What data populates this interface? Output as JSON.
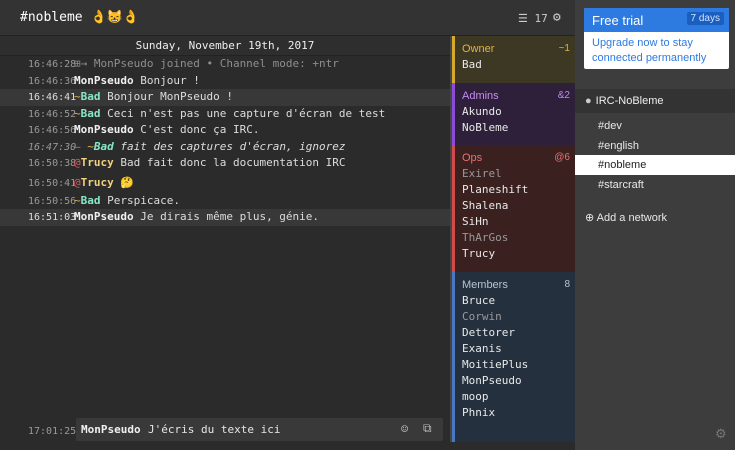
{
  "header": {
    "channel_name": "#nobleme",
    "channel_emoji": "👌😸👌",
    "user_count": "17",
    "userlist_icon": "list-icon",
    "settings_icon": "gear-icon"
  },
  "chat": {
    "date_divider": "Sunday, November 19th, 2017",
    "messages": [
      {
        "time": "16:46:28",
        "type": "join",
        "text": "⊞→ MonPseudo joined  •  Channel mode: +ntr"
      },
      {
        "time": "16:46:36",
        "nick": "MonPseudo",
        "text": "Bonjour !"
      },
      {
        "time": "16:46:41",
        "prefix": "~",
        "nick": "Bad",
        "text": "Bonjour MonPseudo !"
      },
      {
        "time": "16:46:52",
        "prefix": "~",
        "nick": "Bad",
        "text": "Ceci n'est pas une capture d'écran de test"
      },
      {
        "time": "16:46:56",
        "nick": "MonPseudo",
        "text": "C'est donc ça IRC."
      },
      {
        "time": "16:47:30",
        "type": "action",
        "prefix": "~",
        "nick": "Bad",
        "text": "fait des captures d'écran, ignorez"
      },
      {
        "time": "16:50:38",
        "prefix": "@",
        "nick": "Trucy",
        "text": "Bad fait donc la documentation IRC"
      },
      {
        "time": "16:50:41",
        "prefix": "@",
        "nick": "Trucy",
        "text": "🤔"
      },
      {
        "time": "16:50:56",
        "prefix": "~",
        "nick": "Bad",
        "text": "Perspicace."
      },
      {
        "time": "16:51:03",
        "nick": "MonPseudo",
        "text": "Je dirais même plus, génie."
      }
    ]
  },
  "composer": {
    "time": "17:01:25",
    "nick": "MonPseudo",
    "value": "J'écris du texte ici",
    "emoji_icon": "smiley-icon",
    "attach_icon": "copy-icon"
  },
  "userlist": {
    "owner": {
      "label": "Owner",
      "count": "~1",
      "members": [
        "Bad"
      ]
    },
    "admins": {
      "label": "Admins",
      "count": "&2",
      "members": [
        "Akundo",
        "NoBleme"
      ]
    },
    "ops": {
      "label": "Ops",
      "count": "@6",
      "members": [
        "Exirel",
        "Planeshift",
        "Shalena",
        "SiHn",
        "ThArGos",
        "Trucy"
      ]
    },
    "members": {
      "label": "Members",
      "count": "8",
      "members": [
        "Bruce",
        "Corwin",
        "Dettorer",
        "Exanis",
        "MoitiePlus",
        "MonPseudo",
        "moop",
        "Phnix"
      ]
    }
  },
  "sidebar": {
    "trial_title": "Free trial",
    "trial_days": "7 days",
    "trial_text": "Upgrade now to stay connected permanently",
    "network_name": "IRC-NoBleme",
    "channels": [
      "#dev",
      "#english",
      "#nobleme",
      "#starcraft"
    ],
    "active_channel": "#nobleme",
    "add_network": "Add a network"
  },
  "colors": {
    "accent": "#2d7be0",
    "owner": "#d6a82c",
    "admins": "#8a4bd6",
    "ops": "#d24a4a",
    "members": "#4a78c0",
    "nick_bad": "#86e8c8",
    "nick_trucy": "#f0d27c"
  }
}
